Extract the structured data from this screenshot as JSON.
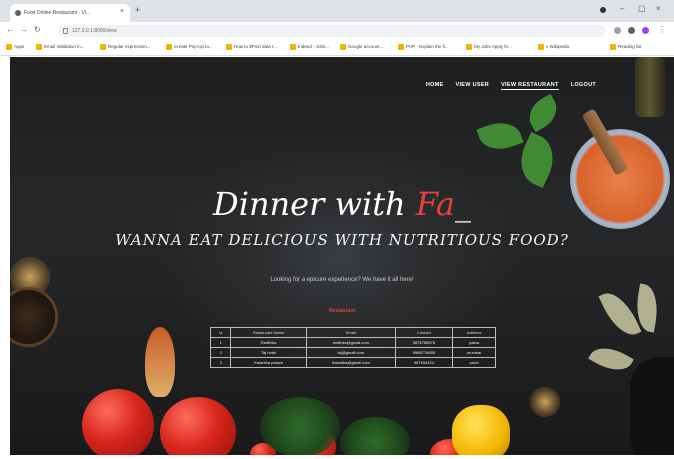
{
  "browser": {
    "tab_title": "Food Online Restaurant - Vi...",
    "address": "127.0.0.1:8000/view",
    "bookmarks": [
      "Apps",
      "Email Validation in...",
      "Regular expression...",
      "Create Pop-Up to...",
      "How to $Post data t...",
      "Indeed - Jobs...",
      "Google account...",
      "PHP - Explain the fi...",
      "My Jobs Apply fo...",
      "c Wikipedia",
      "Reading list"
    ]
  },
  "nav": {
    "items": [
      "HOME",
      "VIEW USER",
      "VIEW RESTAURANT",
      "LOGOUT"
    ],
    "active_index": 2
  },
  "hero": {
    "title": "Dinner with ",
    "title_accent": "Fa",
    "title_cursor": "_",
    "tagline": "WANNA EAT DELICIOUS WITH NUTRITIOUS FOOD?",
    "subtext": "Looking for a epicure experience? We have it all here!"
  },
  "table": {
    "title": "Restaurant",
    "headers": [
      "Id",
      "Restaurant Name",
      "Email",
      "Contact",
      "Address"
    ],
    "rows": [
      [
        "1",
        "Redfinks",
        "redfinks@gmail.com",
        "9876789876",
        "patna"
      ],
      [
        "2",
        "Taj hotel",
        "taj@gmail.com",
        "9988776655",
        "mumbai"
      ],
      [
        "3",
        "Kalantha palace",
        "Kalantha@gmail.com",
        "987654324",
        "pune"
      ]
    ]
  },
  "colors": {
    "accent": "#e8403a",
    "background": "#222325"
  }
}
